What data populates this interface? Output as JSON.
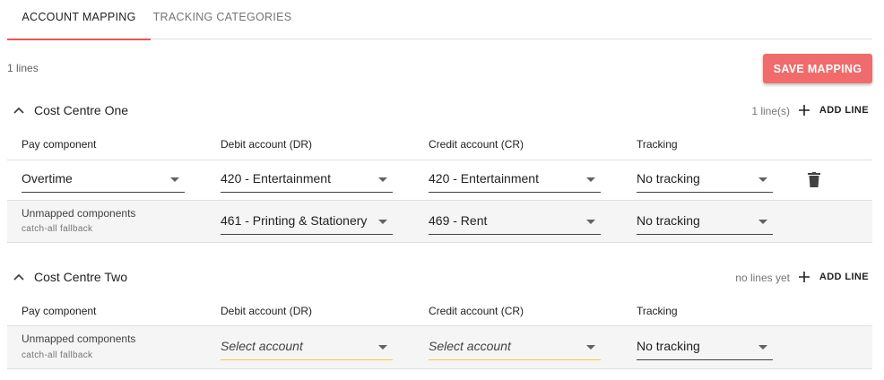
{
  "tabs": [
    {
      "label": "ACCOUNT MAPPING",
      "active": true
    },
    {
      "label": "TRACKING CATEGORIES",
      "active": false
    }
  ],
  "summary": {
    "lines_count": "1 lines"
  },
  "save_button": "SAVE MAPPING",
  "accent_color": "#ef5350",
  "columns": {
    "pay_component": "Pay component",
    "debit": "Debit account (DR)",
    "credit": "Credit account (CR)",
    "tracking": "Tracking"
  },
  "sections": [
    {
      "title": "Cost Centre One",
      "count": "1 line(s)",
      "add_label": "ADD LINE",
      "rows": [
        {
          "pay_component": "Overtime",
          "debit": "420 - Entertainment",
          "credit": "420 - Entertainment",
          "tracking": "No tracking",
          "icon": "trash-icon"
        }
      ],
      "unmapped": {
        "label": "Unmapped components",
        "sub": "catch-all fallback",
        "debit": "461 - Printing & Stationery",
        "credit": "469 - Rent",
        "tracking": "No tracking"
      }
    },
    {
      "title": "Cost Centre Two",
      "count": "no lines yet",
      "add_label": "ADD LINE",
      "rows": [],
      "unmapped": {
        "label": "Unmapped components",
        "sub": "catch-all fallback",
        "debit": "Select account",
        "credit": "Select account",
        "tracking": "No tracking"
      }
    }
  ]
}
